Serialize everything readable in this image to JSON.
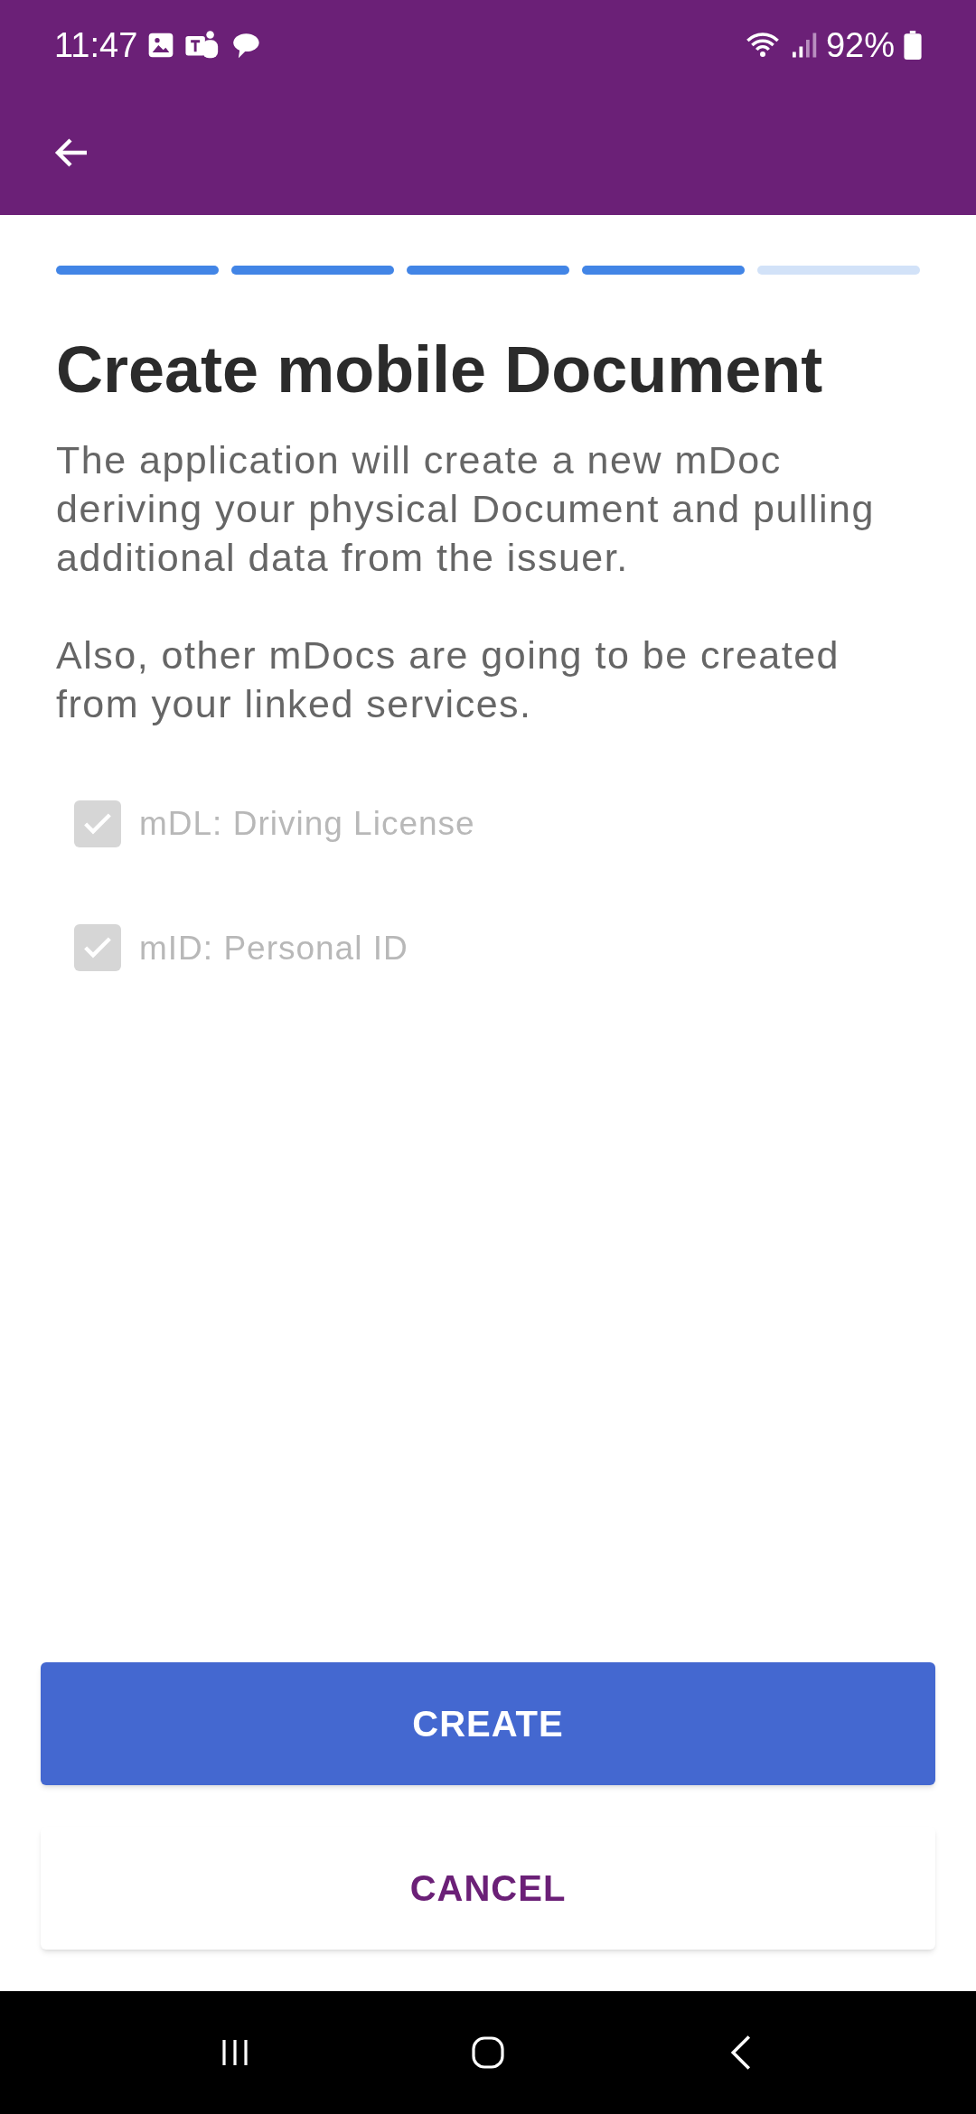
{
  "status_bar": {
    "time": "11:47",
    "battery": "92%"
  },
  "steps": [
    {
      "done": true
    },
    {
      "done": true
    },
    {
      "done": true
    },
    {
      "done": true
    },
    {
      "done": false
    }
  ],
  "title": "Create mobile Document",
  "paragraphs": [
    "The application will create a new mDoc deriving your physical Document and pulling additional data from the issuer.",
    "Also, other mDocs are going to be created from your linked services."
  ],
  "options": [
    {
      "label": "mDL: Driving License",
      "checked": true,
      "disabled": true
    },
    {
      "label": "mID: Personal ID",
      "checked": true,
      "disabled": true
    }
  ],
  "buttons": [
    {
      "label": "CREATE",
      "kind": "primary"
    },
    {
      "label": "CANCEL",
      "kind": "secondary"
    }
  ]
}
